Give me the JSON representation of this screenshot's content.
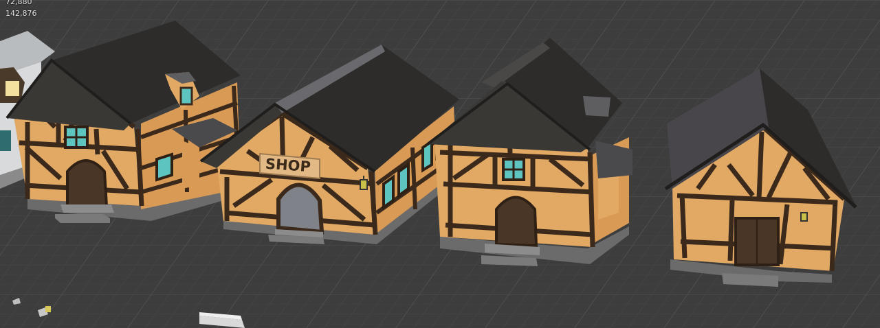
{
  "stats": {
    "line1": "72,880",
    "line2": "142,876"
  },
  "scene": {
    "shop_sign": "SHOP"
  },
  "colors": {
    "ground": "#3d3d3d",
    "grid_minor": "#454545",
    "grid_major": "#4d4d4d",
    "wall": "#e2a964",
    "wall_shade": "#c98f4c",
    "timber": "#3b2a1c",
    "roof": "#2d2c2a",
    "roof_light": "#48464a",
    "stone": "#6e6e6e",
    "window": "#5ec4c0",
    "window_lit": "#f3e1a0",
    "sign": "#e2b884"
  },
  "icons": {
    "shop_lantern": "lantern-icon",
    "house4_lantern": "lantern-icon"
  }
}
